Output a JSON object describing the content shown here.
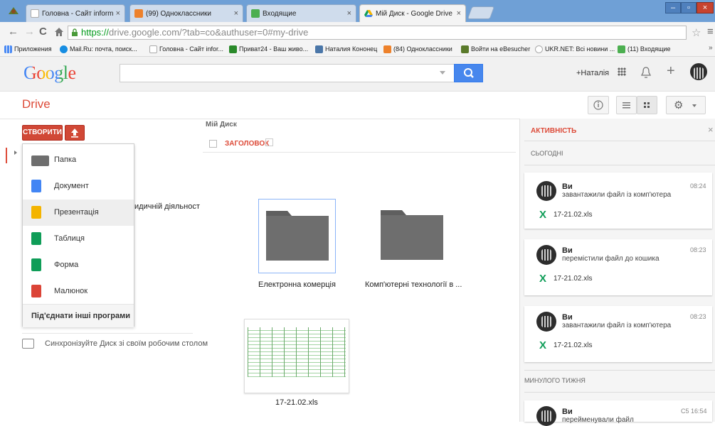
{
  "browser": {
    "tabs": [
      {
        "label": "Головна - Сайт informatika",
        "icon_color": "#c8c8c8"
      },
      {
        "label": "(99) Одноклассники",
        "icon_color": "#ed812b"
      },
      {
        "label": "Входящие",
        "icon_color": "#4caf50"
      },
      {
        "label": "Мій Диск - Google Drive",
        "icon_color": "#1e8e3e"
      }
    ],
    "tab_close": "×",
    "window_buttons": [
      "–",
      "▫",
      "×"
    ],
    "url_scheme": "https://",
    "url_rest": "drive.google.com/?tab=co&authuser=0#my-drive",
    "bookmarks": [
      {
        "label": "Приложения",
        "icon_color": "#4a8af4"
      },
      {
        "label": "Mail.Ru: почта, поиск...",
        "icon_color": "#168de2"
      },
      {
        "label": "Головна - Сайт infor...",
        "icon_color": "#c8c8c8"
      },
      {
        "label": "Приват24 - Ваш живо...",
        "icon_color": "#2a8a2a"
      },
      {
        "label": "Наталия Кононец",
        "icon_color": "#4a76a8"
      },
      {
        "label": "(84) Одноклассники",
        "icon_color": "#ed812b"
      },
      {
        "label": "Войти на eBesucher",
        "icon_color": "#5a7a2a"
      },
      {
        "label": "UKR.NET: Всі новини ...",
        "icon_color": "#ffffff"
      },
      {
        "label": "(11) Входящие",
        "icon_color": "#4caf50"
      }
    ],
    "bookmarks_more": "»"
  },
  "google": {
    "logo": "Google",
    "user_name": "+Наталія"
  },
  "drive": {
    "title": "Drive",
    "create_label": "СТВОРИТИ",
    "create_menu": [
      {
        "label": "Папка",
        "icon_color": "#6e6e6e"
      },
      {
        "label": "Документ",
        "icon_color": "#4285f4"
      },
      {
        "label": "Презентація",
        "icon_color": "#f4b400"
      },
      {
        "label": "Таблиця",
        "icon_color": "#0f9d58"
      },
      {
        "label": "Форма",
        "icon_color": "#0f9d58"
      },
      {
        "label": "Малюнок",
        "icon_color": "#db4437"
      }
    ],
    "connect_more": "Під'єднати інші програми",
    "partial_label": "идичній діяльност",
    "sync_text": "Синхронізуйте Диск зі своїм робочим столом",
    "breadcrumb": "Мій Диск",
    "sort_header": "ЗАГОЛОВОК",
    "folders": [
      {
        "name": "Електронна комерція"
      },
      {
        "name": "Комп'ютерні технології в ..."
      }
    ],
    "files": [
      {
        "name": "17-21.02.xls"
      }
    ]
  },
  "activity": {
    "title": "АКТИВНІСТЬ",
    "close": "×",
    "today_label": "СЬОГОДНІ",
    "last_week_label": "МИНУЛОГО ТИЖНЯ",
    "items": [
      {
        "user": "Ви",
        "action": "завантажили файл із комп'ютера",
        "time": "08:24",
        "file": "17-21.02.xls"
      },
      {
        "user": "Ви",
        "action": "перемістили файл до кошика",
        "time": "08:23",
        "file": "17-21.02.xls"
      },
      {
        "user": "Ви",
        "action": "завантажили файл із комп'ютера",
        "time": "08:23",
        "file": "17-21.02.xls"
      }
    ],
    "week_item": {
      "user": "Ви",
      "action": "перейменували файл",
      "time": "С5 16:54"
    },
    "xls_glyph": "X"
  },
  "colors": {
    "accent_red": "#d14836",
    "drive_red": "#dd4b39",
    "search_blue": "#4787ed"
  }
}
